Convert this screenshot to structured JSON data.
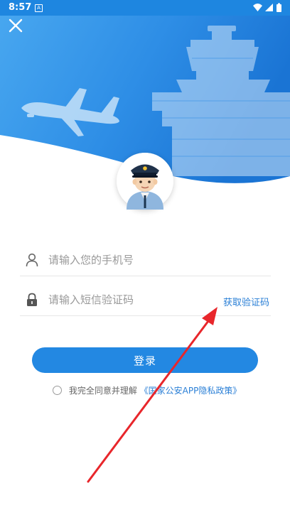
{
  "status_bar": {
    "time": "8:57",
    "notification_icon_letter": "A",
    "icons": [
      "wifi-icon",
      "signal-icon",
      "battery-icon"
    ]
  },
  "header": {
    "close_icon": "close-icon"
  },
  "form": {
    "phone_placeholder": "请输入您的手机号",
    "code_placeholder": "请输入短信验证码",
    "get_code_label": "获取验证码",
    "login_label": "登录",
    "agreement_text": "我完全同意并理解",
    "agreement_link": "《国家公安APP隐私政策》"
  },
  "colors": {
    "brand_blue": "#2388e2",
    "link_blue": "#2a7fd6",
    "annotation_arrow": "#e8262b"
  }
}
